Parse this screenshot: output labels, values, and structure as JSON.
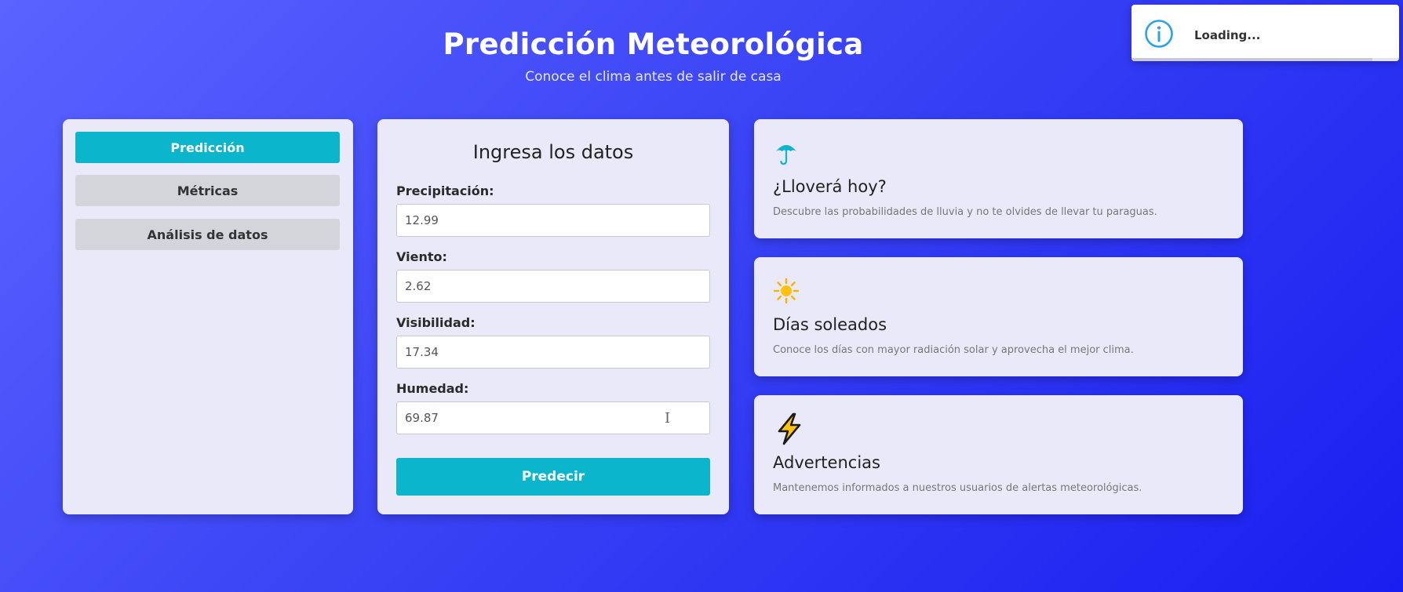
{
  "header": {
    "title": "Predicción Meteorológica",
    "subtitle": "Conoce el clima antes de salir de casa"
  },
  "sidebar": {
    "items": [
      {
        "label": "Predicción",
        "active": true
      },
      {
        "label": "Métricas",
        "active": false
      },
      {
        "label": "Análisis de datos",
        "active": false
      }
    ]
  },
  "form": {
    "title": "Ingresa los datos",
    "fields": [
      {
        "label": "Precipitación:",
        "value": "12.99"
      },
      {
        "label": "Viento:",
        "value": "2.62"
      },
      {
        "label": "Visibilidad:",
        "value": "17.34"
      },
      {
        "label": "Humedad:",
        "value": "69.87"
      }
    ],
    "submit_label": "Predecir"
  },
  "cards": [
    {
      "icon": "umbrella-icon",
      "title": "¿Lloverá hoy?",
      "description": "Descubre las probabilidades de lluvia y no te olvides de llevar tu paraguas."
    },
    {
      "icon": "sun-icon",
      "title": "Días soleados",
      "description": "Conoce los días con mayor radiación solar y aprovecha el mejor clima."
    },
    {
      "icon": "lightning-icon",
      "title": "Advertencias",
      "description": "Mantenemos informados a nuestros usuarios de alertas meteorológicas."
    }
  ],
  "toast": {
    "icon": "info-icon",
    "text": "Loading...",
    "progress": 0.9
  },
  "colors": {
    "accent": "#0bb5cc",
    "panel": "#e9e9f9",
    "background_start": "#5a63ff",
    "background_end": "#1a1ef0"
  }
}
